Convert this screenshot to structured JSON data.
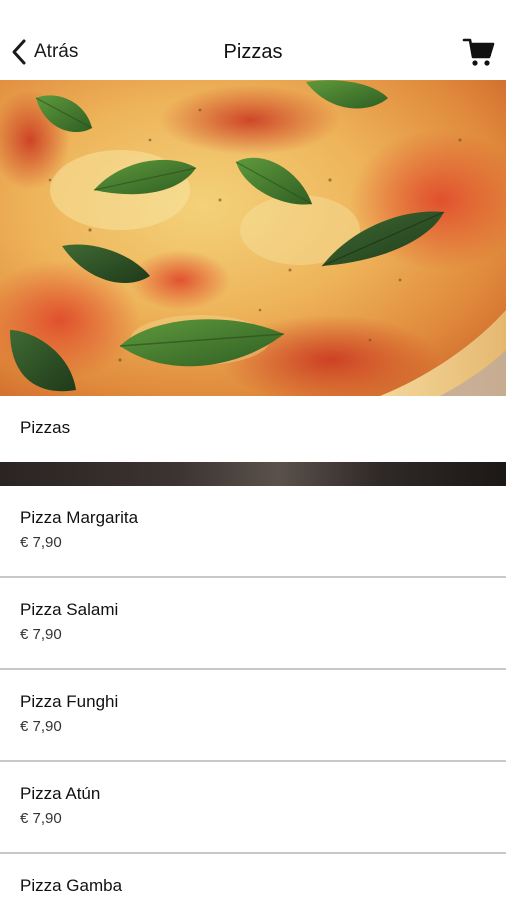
{
  "navbar": {
    "back_label": "Atrás",
    "title": "Pizzas",
    "back_icon": "chevron-left-icon",
    "cart_icon": "shopping-cart-icon"
  },
  "hero": {
    "image": "pizza-margherita-photo"
  },
  "category": {
    "label": "Pizzas"
  },
  "products": [
    {
      "name": "Pizza Margarita",
      "price": "€ 7,90"
    },
    {
      "name": "Pizza Salami",
      "price": "€ 7,90"
    },
    {
      "name": "Pizza Funghi",
      "price": "€ 7,90"
    },
    {
      "name": "Pizza Atún",
      "price": "€ 7,90"
    },
    {
      "name": "Pizza Gamba",
      "price": ""
    }
  ],
  "colors": {
    "background": "#ffffff",
    "text": "#111111",
    "divider": "#c8c8c8"
  }
}
